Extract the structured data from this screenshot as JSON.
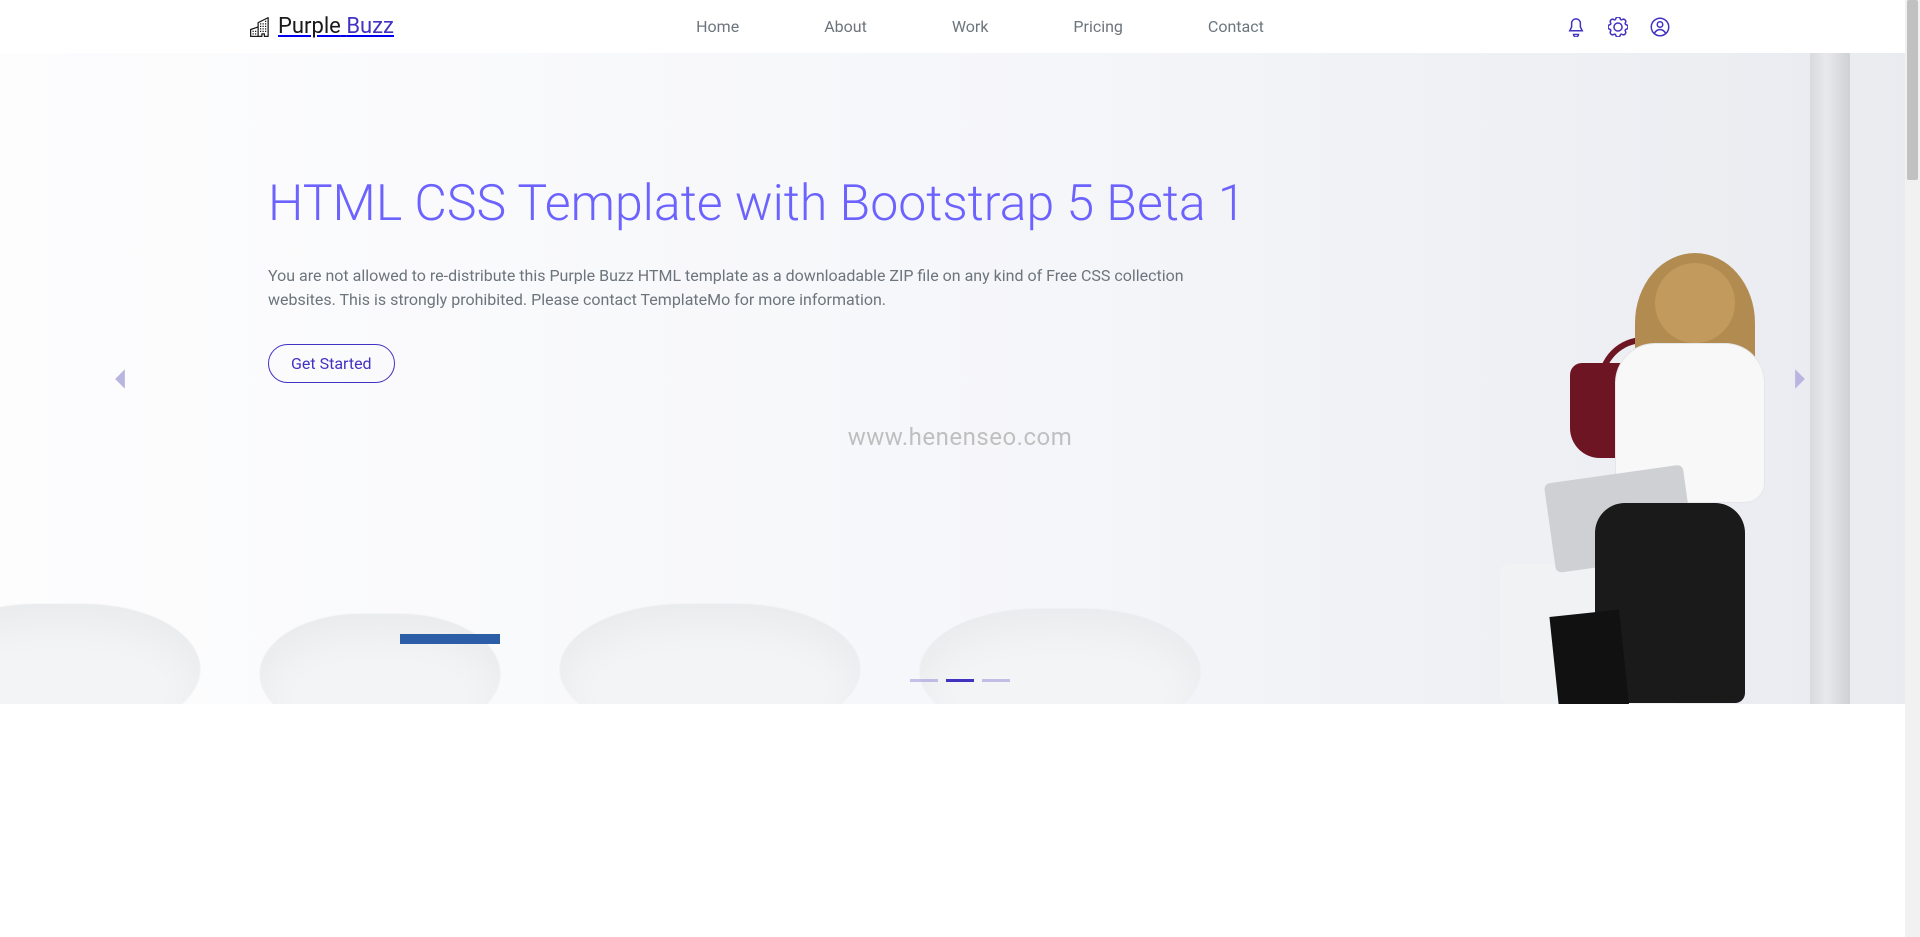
{
  "brand": {
    "first": "Purple",
    "second": "Buzz"
  },
  "nav": [
    {
      "label": "Home"
    },
    {
      "label": "About"
    },
    {
      "label": "Work"
    },
    {
      "label": "Pricing"
    },
    {
      "label": "Contact"
    }
  ],
  "hero": {
    "title": "HTML CSS Template with Bootstrap 5 Beta 1",
    "subtitle": "You are not allowed to re-distribute this Purple Buzz HTML template as a downloadable ZIP file on any kind of Free CSS collection websites. This is strongly prohibited. Please contact TemplateMo for more information.",
    "cta": "Get Started"
  },
  "watermark": "www.henenseo.com",
  "carousel": {
    "slides_count": 3,
    "active_index": 1
  },
  "colors": {
    "accent": "#4232c2",
    "heading": "#6c63ff",
    "muted": "#6c757d"
  }
}
